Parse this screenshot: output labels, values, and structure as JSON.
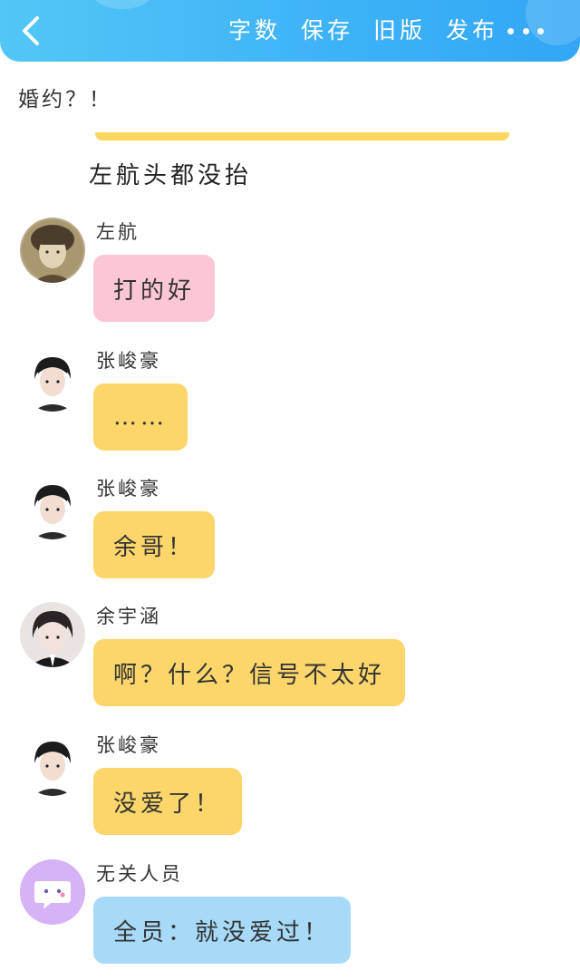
{
  "header": {
    "menu": [
      "字数",
      "保存",
      "旧版",
      "发布"
    ],
    "colors": {
      "bar_start": "#52c7f6",
      "bar_end": "#33a6f5"
    }
  },
  "story": {
    "intro": "婚约？！",
    "narration": "左航头都没抬"
  },
  "messages": [
    {
      "sender": "左航",
      "text": "打的好",
      "bubble_color": "#fcc6d6",
      "avatar": "photo-avatar-zuohang"
    },
    {
      "sender": "张峻豪",
      "text": "……",
      "bubble_color": "#fcd66a",
      "avatar": "photo-avatar-zhangjunhao"
    },
    {
      "sender": "张峻豪",
      "text": "余哥！",
      "bubble_color": "#fcd66a",
      "avatar": "photo-avatar-zhangjunhao"
    },
    {
      "sender": "余宇涵",
      "text": "啊？什么？信号不太好",
      "bubble_color": "#fcd66a",
      "avatar": "photo-avatar-yuyuhan"
    },
    {
      "sender": "张峻豪",
      "text": "没爱了！",
      "bubble_color": "#fcd66a",
      "avatar": "photo-avatar-zhangjunhao"
    },
    {
      "sender": "无关人员",
      "text": "全员：就没爱过！",
      "bubble_color": "#a6daf8",
      "avatar": "chat-bubble-icon"
    }
  ]
}
